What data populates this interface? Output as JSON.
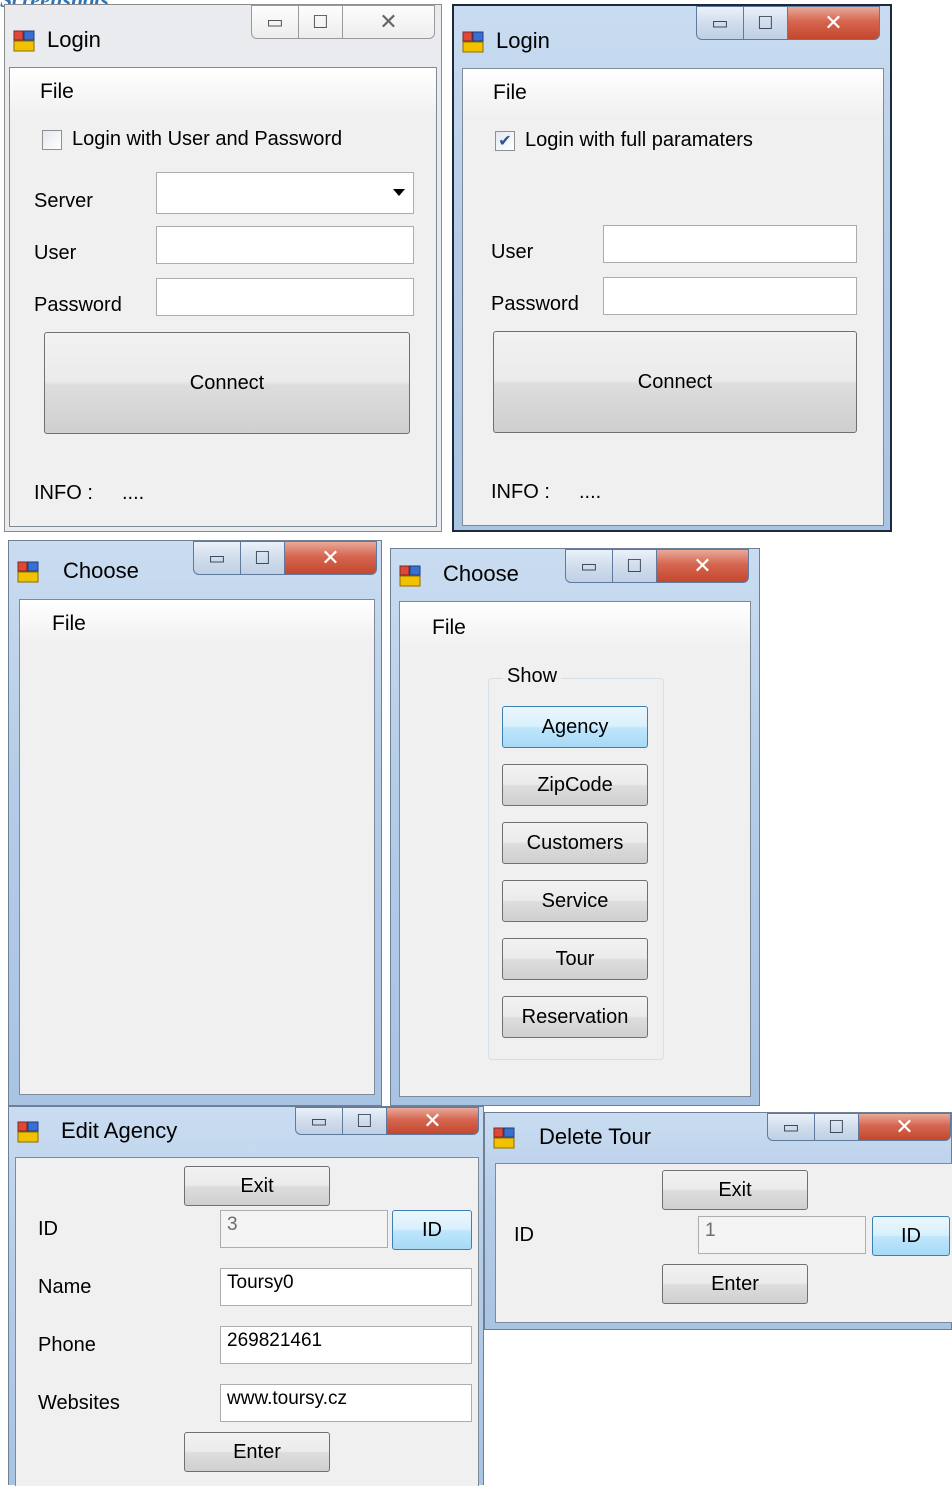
{
  "heading": "Screenshots",
  "icons": {
    "app": "form-icon",
    "minimize": "minimize-icon",
    "maximize": "maximize-icon",
    "close": "close-icon"
  },
  "colors": {
    "heading": "#2e74b5",
    "close_button": "#c4472e"
  },
  "login1": {
    "title": "Login",
    "menu_file": "File",
    "checkbox_label": "Login with User and Password",
    "checkbox_checked": false,
    "server_label": "Server",
    "server_value": "",
    "user_label": "User",
    "user_value": "",
    "password_label": "Password",
    "password_value": "",
    "connect": "Connect",
    "info_label": "INFO :",
    "info_value": "...."
  },
  "login2": {
    "title": "Login",
    "menu_file": "File",
    "checkbox_label": "Login with full paramaters",
    "checkbox_checked": true,
    "user_label": "User",
    "user_value": "",
    "password_label": "Password",
    "password_value": "",
    "connect": "Connect",
    "info_label": "INFO :",
    "info_value": "...."
  },
  "choose1": {
    "title": "Choose",
    "menu_file": "File"
  },
  "choose2": {
    "title": "Choose",
    "menu_file": "File",
    "group_title": "Show",
    "buttons": [
      "Agency",
      "ZipCode",
      "Customers",
      "Service",
      "Tour",
      "Reservation"
    ]
  },
  "edit_agency": {
    "title": "Edit Agency",
    "exit": "Exit",
    "id_label": "ID",
    "id_value": "3",
    "id_button": "ID",
    "name_label": "Name",
    "name_value": "Toursy0",
    "phone_label": "Phone",
    "phone_value": "269821461",
    "websites_label": "Websites",
    "websites_value": "www.toursy.cz",
    "enter": "Enter"
  },
  "delete_tour": {
    "title": "Delete Tour",
    "exit": "Exit",
    "id_label": "ID",
    "id_value": "1",
    "id_button": "ID",
    "enter": "Enter"
  }
}
